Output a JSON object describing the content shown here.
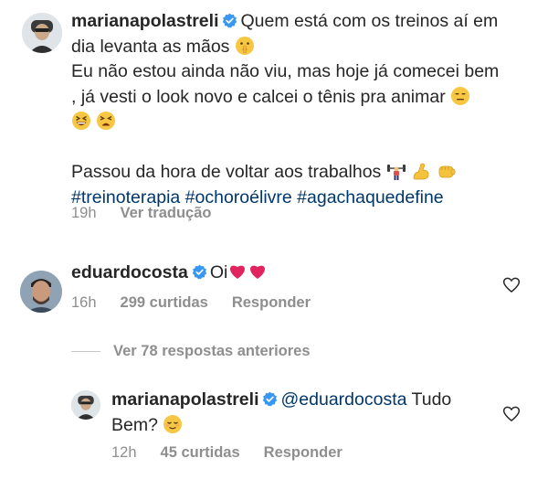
{
  "comments": [
    {
      "username": "marianapolastreli",
      "verified": true,
      "lines": [
        "Quem está com os treinos aí em",
        "dia levanta as mãos",
        "Eu não estou ainda não viu, mas hoje já comecei bem",
        ", já vesti o look novo e calcei o tênis pra animar",
        "Passou da hora de voltar aos trabalhos"
      ],
      "hashtags": [
        "#treinoterapia",
        "#ochoroélivre",
        "#agachaquedefine"
      ],
      "time": "19h",
      "translate_label": "Ver tradução"
    },
    {
      "username": "eduardocosta",
      "verified": true,
      "text": "Oi",
      "time": "16h",
      "likes_label": "299 curtidas",
      "reply_label": "Responder"
    }
  ],
  "replies_toggle": "Ver 78 respostas anteriores",
  "reply": {
    "username": "marianapolastreli",
    "verified": true,
    "mention": "@eduardocosta",
    "text_line1": "Tudo",
    "text_line2": "Bem?",
    "time": "12h",
    "likes_label": "45 curtidas",
    "reply_label": "Responder"
  },
  "colors": {
    "text": "#262626",
    "meta": "#8e8e8e",
    "hashtag": "#00376b",
    "verified": "#3897f0",
    "heart_red": "#e0245e"
  }
}
